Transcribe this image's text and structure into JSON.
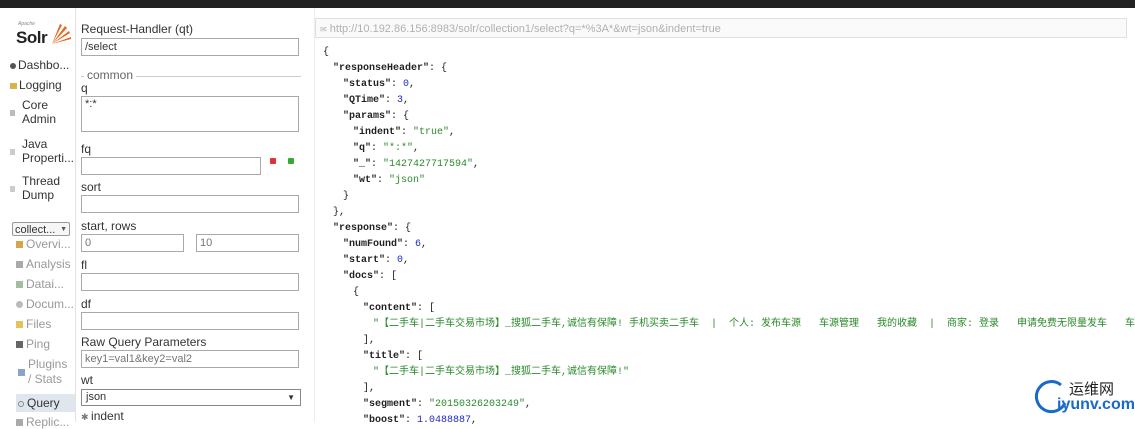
{
  "sidebar": {
    "logo_small": "Apache",
    "logo_text": "Solr",
    "items": [
      {
        "label": "Dashbo..."
      },
      {
        "label": "Logging"
      },
      {
        "label_lines": [
          "Core",
          "Admin"
        ]
      },
      {
        "label_lines": [
          "Java",
          "Properti..."
        ]
      },
      {
        "label_lines": [
          "Thread",
          "Dump"
        ]
      }
    ],
    "core_selector": "collect...",
    "core_items": [
      {
        "label": "Overvi..."
      },
      {
        "label": "Analysis"
      },
      {
        "label": "Datai..."
      },
      {
        "label": "Docum..."
      },
      {
        "label": "Files"
      },
      {
        "label": "Ping"
      },
      {
        "label_lines": [
          "Plugins",
          "/ Stats"
        ]
      },
      {
        "label": "Query"
      },
      {
        "label": "Replic..."
      }
    ]
  },
  "form": {
    "qt_label": "Request-Handler (qt)",
    "qt_value": "/select",
    "common_legend": "common",
    "q_label": "q",
    "q_value": "*:*",
    "fq_label": "fq",
    "fq_value": "",
    "sort_label": "sort",
    "sort_value": "",
    "start_rows_label": "start, rows",
    "start_placeholder": "0",
    "rows_placeholder": "10",
    "fl_label": "fl",
    "df_label": "df",
    "raw_label": "Raw Query Parameters",
    "raw_placeholder": "key1=val1&key2=val2",
    "wt_label": "wt",
    "wt_value": "json",
    "indent_label": "indent"
  },
  "result": {
    "url": "http://10.192.86.156:8983/solr/collection1/select?q=*%3A*&wt=json&indent=true",
    "lines": [
      {
        "i": 0,
        "parts": [
          {
            "t": "{"
          }
        ]
      },
      {
        "i": 1,
        "parts": [
          {
            "t": "\"responseHeader\"",
            "c": "k"
          },
          {
            "t": ": {"
          }
        ]
      },
      {
        "i": 2,
        "parts": [
          {
            "t": "\"status\"",
            "c": "k"
          },
          {
            "t": ": "
          },
          {
            "t": "0",
            "c": "num"
          },
          {
            "t": ","
          }
        ]
      },
      {
        "i": 2,
        "parts": [
          {
            "t": "\"QTime\"",
            "c": "k"
          },
          {
            "t": ": "
          },
          {
            "t": "3",
            "c": "num"
          },
          {
            "t": ","
          }
        ]
      },
      {
        "i": 2,
        "parts": [
          {
            "t": "\"params\"",
            "c": "k"
          },
          {
            "t": ": {"
          }
        ]
      },
      {
        "i": 3,
        "parts": [
          {
            "t": "\"indent\"",
            "c": "k"
          },
          {
            "t": ": "
          },
          {
            "t": "\"true\"",
            "c": "str"
          },
          {
            "t": ","
          }
        ]
      },
      {
        "i": 3,
        "parts": [
          {
            "t": "\"q\"",
            "c": "k"
          },
          {
            "t": ": "
          },
          {
            "t": "\"*:*\"",
            "c": "str"
          },
          {
            "t": ","
          }
        ]
      },
      {
        "i": 3,
        "parts": [
          {
            "t": "\"_\"",
            "c": "k"
          },
          {
            "t": ": "
          },
          {
            "t": "\"1427427717594\"",
            "c": "str"
          },
          {
            "t": ","
          }
        ]
      },
      {
        "i": 3,
        "parts": [
          {
            "t": "\"wt\"",
            "c": "k"
          },
          {
            "t": ": "
          },
          {
            "t": "\"json\"",
            "c": "str"
          }
        ]
      },
      {
        "i": 2,
        "parts": [
          {
            "t": "}"
          }
        ]
      },
      {
        "i": 1,
        "parts": [
          {
            "t": "},"
          }
        ]
      },
      {
        "i": 1,
        "parts": [
          {
            "t": "\"response\"",
            "c": "k"
          },
          {
            "t": ": {"
          }
        ]
      },
      {
        "i": 2,
        "parts": [
          {
            "t": "\"numFound\"",
            "c": "k"
          },
          {
            "t": ": "
          },
          {
            "t": "6",
            "c": "num"
          },
          {
            "t": ","
          }
        ]
      },
      {
        "i": 2,
        "parts": [
          {
            "t": "\"start\"",
            "c": "k"
          },
          {
            "t": ": "
          },
          {
            "t": "0",
            "c": "num"
          },
          {
            "t": ","
          }
        ]
      },
      {
        "i": 2,
        "parts": [
          {
            "t": "\"docs\"",
            "c": "k"
          },
          {
            "t": ": ["
          }
        ]
      },
      {
        "i": 3,
        "parts": [
          {
            "t": "{"
          }
        ]
      },
      {
        "i": 4,
        "parts": [
          {
            "t": "\"content\"",
            "c": "k"
          },
          {
            "t": ": ["
          }
        ]
      },
      {
        "i": 5,
        "parts": [
          {
            "t": "\"【二手车|二手车交易市场】_搜狐二手车,诚信有保障! 手机买卖二手车  |  个人: 发布车源   车源管理   我的收藏  |  商家: 登录   申请免费无限量发车   车",
            "c": "str"
          }
        ]
      },
      {
        "i": 4,
        "parts": [
          {
            "t": "],"
          }
        ]
      },
      {
        "i": 4,
        "parts": [
          {
            "t": "\"title\"",
            "c": "k"
          },
          {
            "t": ": ["
          }
        ]
      },
      {
        "i": 5,
        "parts": [
          {
            "t": "\"【二手车|二手车交易市场】_搜狐二手车,诚信有保障!\"",
            "c": "str"
          }
        ]
      },
      {
        "i": 4,
        "parts": [
          {
            "t": "],"
          }
        ]
      },
      {
        "i": 4,
        "parts": [
          {
            "t": "\"segment\"",
            "c": "k"
          },
          {
            "t": ": "
          },
          {
            "t": "\"20150326203249\"",
            "c": "str"
          },
          {
            "t": ","
          }
        ]
      },
      {
        "i": 4,
        "parts": [
          {
            "t": "\"boost\"",
            "c": "k"
          },
          {
            "t": ": "
          },
          {
            "t": "1.0488887",
            "c": "num"
          },
          {
            "t": ","
          }
        ]
      }
    ]
  },
  "watermark": {
    "line1": "运维网",
    "line2": "iyunv.com"
  },
  "colors": {
    "accent_active": "#dfe6ee",
    "json_number": "#1f2ac7",
    "json_string": "#2a8a2a",
    "remove_button": "#d33",
    "add_button": "#3a3"
  }
}
